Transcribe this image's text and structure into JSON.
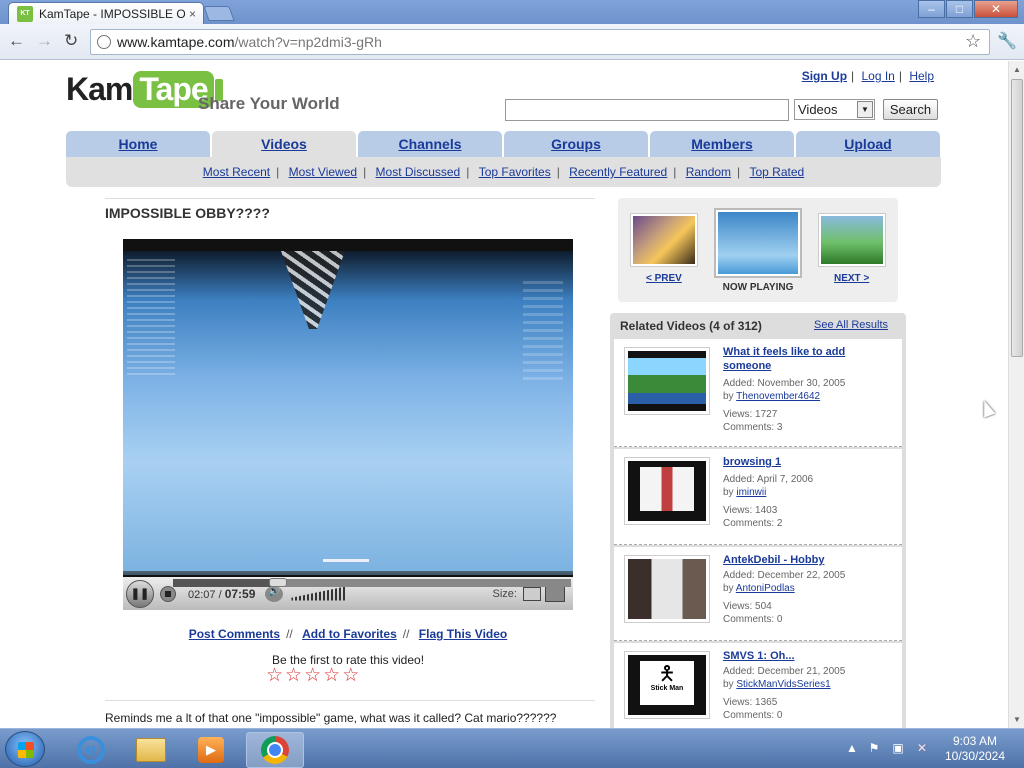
{
  "browser": {
    "tab_title": "KamTape - IMPOSSIBLE OB",
    "tab_close": "×",
    "url_host": "www.kamtape.com",
    "url_path": "/watch?v=np2dmi3-gRh",
    "win_min": "–",
    "win_max": "□",
    "win_close": "✕"
  },
  "header": {
    "logo_kam": "Kam",
    "logo_tape": "Tape",
    "tagline": "Share Your World",
    "links": [
      "Sign Up",
      "Log In",
      "Help"
    ],
    "search_value": "",
    "search_category": "Videos",
    "search_button": "Search"
  },
  "nav": {
    "tabs": [
      "Home",
      "Videos",
      "Channels",
      "Groups",
      "Members",
      "Upload"
    ],
    "active": "Videos",
    "subnav": [
      "Most Recent",
      "Most Viewed",
      "Most Discussed",
      "Top Favorites",
      "Recently Featured",
      "Random",
      "Top Rated"
    ]
  },
  "video": {
    "title": "IMPOSSIBLE OBBY????",
    "current_time": "02:07",
    "duration": "07:59",
    "progress": 0.265,
    "size_label": "Size:",
    "actions": [
      "Post Comments",
      "Add to Favorites",
      "Flag This Video"
    ],
    "rate_prompt": "Be the first to rate this video!",
    "stars": 5,
    "comment": "Reminds me a lt of that one \"impossible\" game, what was it called? Cat mario??????"
  },
  "prevnext": {
    "prev": "< PREV",
    "now_playing": "NOW PLAYING",
    "next": "NEXT >"
  },
  "related": {
    "header": "Related Videos (4 of 312)",
    "see_all": "See All Results",
    "items": [
      {
        "title": "What it feels like to add someone",
        "added": "Added: November 30, 2005",
        "by_label": "by",
        "user": "Thenovember4642",
        "views": "Views: 1727",
        "comments": "Comments: 3"
      },
      {
        "title": "browsing 1",
        "added": "Added: April 7, 2006",
        "by_label": "by",
        "user": "iminwii",
        "views": "Views: 1403",
        "comments": "Comments: 2"
      },
      {
        "title": "AntekDebil - Hobby",
        "added": "Added: December 22, 2005",
        "by_label": "by",
        "user": "AntoniPodlas",
        "views": "Views: 504",
        "comments": "Comments: 0"
      },
      {
        "title": "SMVS 1: Oh...",
        "added": "Added: December 21, 2005",
        "by_label": "by",
        "user": "StickManVidsSeries1",
        "views": "Views: 1365",
        "comments": "Comments: 0",
        "thumb_text": "Stick Man"
      }
    ]
  },
  "taskbar": {
    "time": "9:03 AM",
    "date": "10/30/2024"
  }
}
